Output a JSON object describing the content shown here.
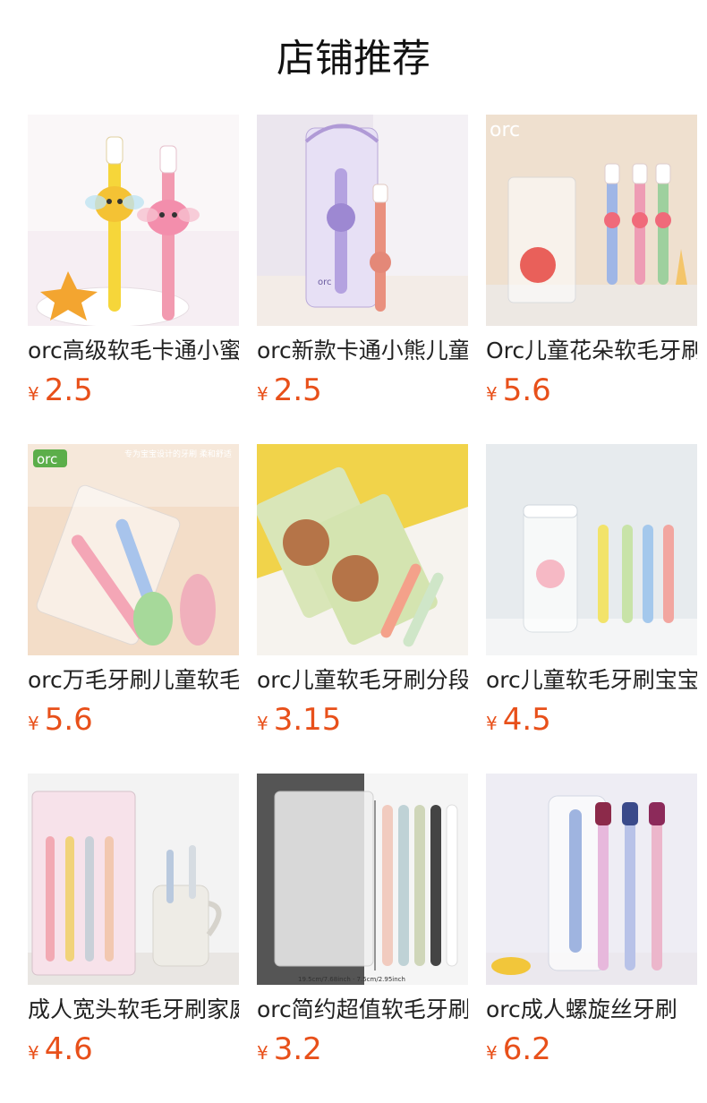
{
  "header": {
    "title": "店铺推荐"
  },
  "currency": "¥",
  "products": [
    {
      "name": "orc高级软毛卡通小蜜蜂儿童牙刷",
      "price": "2.5",
      "icon": "bee-toothbrush-image",
      "badge": ""
    },
    {
      "name": "orc新款卡通小熊儿童软毛牙刷",
      "price": "2.5",
      "icon": "bear-toothbrush-image",
      "badge": ""
    },
    {
      "name": "Orc儿童花朵软毛牙刷",
      "price": "5.6",
      "icon": "flower-toothbrush-image",
      "badge": "orc"
    },
    {
      "name": "orc万毛牙刷儿童软毛牙刷",
      "price": "5.6",
      "icon": "kids-toothbrush-pack-image",
      "badge": "orc",
      "overlay": "专为宝宝设计的牙刷 柔和舒适"
    },
    {
      "name": "orc儿童软毛牙刷分段",
      "price": "3.15",
      "icon": "squirrel-card-toothbrush-image",
      "badge": ""
    },
    {
      "name": "orc儿童软毛牙刷宝宝",
      "price": "4.5",
      "icon": "toothbrush-tube-image",
      "badge": ""
    },
    {
      "name": "成人宽头软毛牙刷家庭装",
      "price": "4.6",
      "icon": "adult-toothbrush-cup-image",
      "badge": ""
    },
    {
      "name": "orc简约超值软毛牙刷",
      "price": "3.2",
      "icon": "adult-toothbrush-set-image",
      "badge": "",
      "overlay": "19.5cm/7.68inch · 7.5cm/2.95inch"
    },
    {
      "name": "orc成人螺旋丝牙刷",
      "price": "6.2",
      "icon": "spiral-toothbrush-image",
      "badge": ""
    }
  ]
}
